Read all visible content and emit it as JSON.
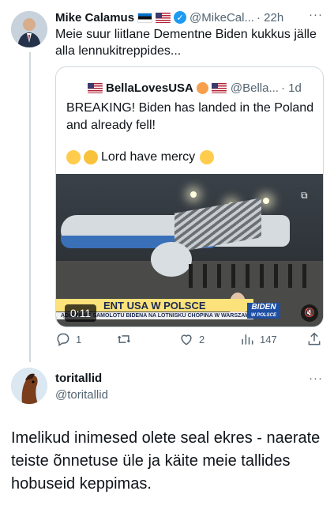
{
  "tweet": {
    "display_name": "Mike Calamus",
    "handle": "@MikeCal...",
    "time": "· 22h",
    "text": "Meie suur liitlane Dementne Biden kukkus jälle alla lennukitreppides..."
  },
  "quoted_tweet": {
    "display_name": "BellaLovesUSA",
    "handle": "@Bella...",
    "time": "· 1d",
    "text": "BREAKING! Biden has landed in the Poland and already fell!",
    "line3": "Lord have mercy",
    "video": {
      "timestamp": "0:11",
      "ticker_main": "ENT USA W POLSCE",
      "ticker_sub": "ĄDOWANIE SAMOLOTU BIDENA NA LOTNISKU CHOPINA W WARSZAWIE",
      "badge_top": "BIDEN",
      "badge_bottom": "W POLSCE"
    }
  },
  "actions": {
    "reply_count": "1",
    "retweet_count": "",
    "like_count": "2",
    "view_count": "147"
  },
  "reply": {
    "display_name": "toritallid",
    "handle": "@toritallid",
    "text": "Imelikud inimesed olete seal ekres - naerate teiste õnnetuse üle ja käite meie tallides hobuseid keppimas."
  },
  "colors": {
    "accent": "#1d9bf0",
    "muted": "#536471",
    "border": "#cfd9de"
  }
}
